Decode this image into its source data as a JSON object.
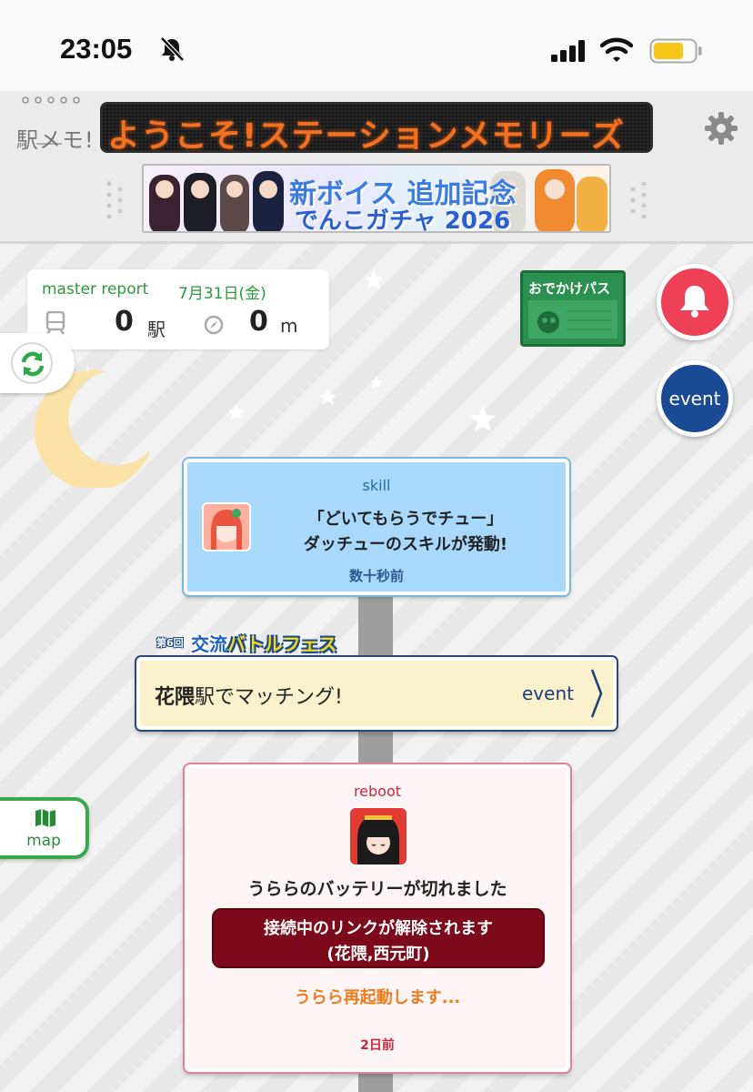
{
  "status_bar": {
    "time": "23:05"
  },
  "header": {
    "logo_text": "駅メモ!",
    "ticker_text": "ようこそ!ステーションメモリーズ",
    "banner": {
      "title": "新ボイス 追加記念",
      "subtitle": "でんこガチャ 2026"
    }
  },
  "report": {
    "title": "master report",
    "date": "7月31日(金)",
    "stations_value": "0",
    "stations_unit": "駅",
    "distance_value": "0",
    "distance_unit": "m"
  },
  "pass": {
    "title": "おでかけパス"
  },
  "event_button": {
    "label": "event"
  },
  "map_button": {
    "label": "map"
  },
  "skill_card": {
    "label": "skill",
    "line1": "「どいてもらうでチュー」",
    "line2": "ダッチューのスキルが発動!",
    "time": "数十秒前"
  },
  "fest": {
    "small": "第6回",
    "main_part1": "交流",
    "main_part2": "バトルフェス"
  },
  "match_card": {
    "station": "花隈",
    "text": "駅でマッチング!",
    "link_label": "event"
  },
  "reboot_card": {
    "label": "reboot",
    "message": "うららのバッテリーが切れました",
    "box_line1": "接続中のリンクが解除されます",
    "box_line2": "(花隈,西元町)",
    "status": "うらら再起動します...",
    "time": "2日前"
  },
  "colors": {
    "accent_green": "#2b9a3a",
    "event_blue": "#1a4a93",
    "bell_red": "#ee4157",
    "reboot_red": "#c8283c"
  }
}
